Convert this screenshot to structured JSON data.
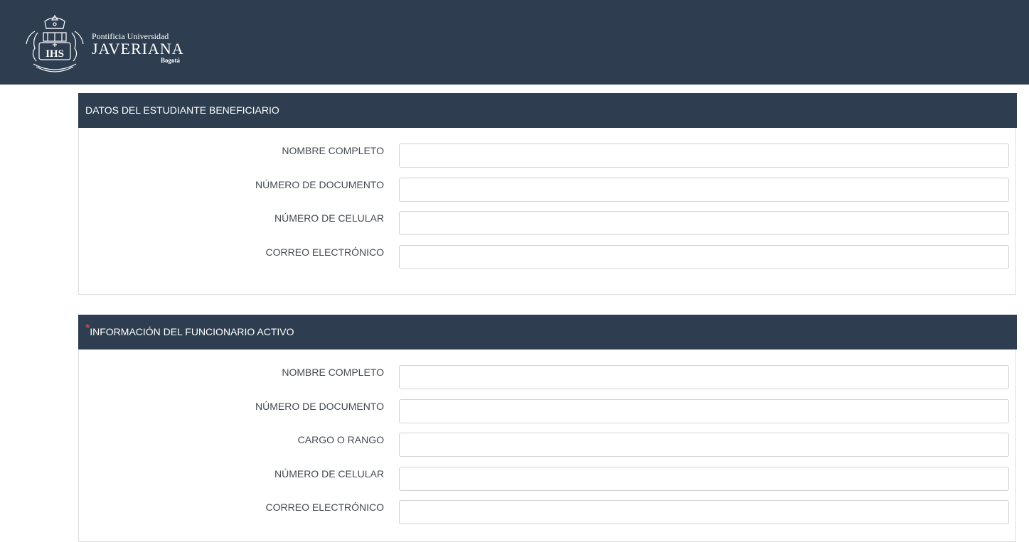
{
  "header": {
    "logo": {
      "line1": "Pontificia Universidad",
      "line2": "JAVERIANA",
      "line3": "Bogotá",
      "crest_text": "IHS"
    }
  },
  "sections": [
    {
      "title": "DATOS DEL ESTUDIANTE BENEFICIARIO",
      "required": false,
      "fields": [
        {
          "label": "NOMBRE COMPLETO",
          "value": "",
          "placeholder": ""
        },
        {
          "label": "NÚMERO DE DOCUMENTO",
          "value": "",
          "placeholder": ""
        },
        {
          "label": "NÚMERO DE CELULAR",
          "value": "",
          "placeholder": ""
        },
        {
          "label": "CORREO ELECTRÓNICO",
          "value": "",
          "placeholder": ""
        }
      ]
    },
    {
      "title": "INFORMACIÓN DEL FUNCIONARIO ACTIVO",
      "required": true,
      "required_mark": "*",
      "fields": [
        {
          "label": "NOMBRE COMPLETO",
          "value": "",
          "placeholder": ""
        },
        {
          "label": "NÚMERO DE DOCUMENTO",
          "value": "",
          "placeholder": ""
        },
        {
          "label": "CARGO O RANGO",
          "value": "",
          "placeholder": ""
        },
        {
          "label": "NÚMERO DE CELULAR",
          "value": "",
          "placeholder": ""
        },
        {
          "label": "CORREO ELECTRÓNICO",
          "value": "",
          "placeholder": ""
        }
      ]
    }
  ],
  "colors": {
    "header_bg": "#2e3e50",
    "required": "#e5383b",
    "label_text": "#444a52",
    "input_border": "#cfd3d8"
  }
}
